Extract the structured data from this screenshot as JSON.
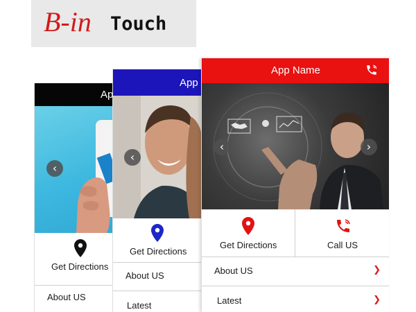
{
  "logo": {
    "b_in": "B-in",
    "touch": "Touch"
  },
  "phones": {
    "back": {
      "header_title": "Ap",
      "tiles": {
        "directions_label": "Get Directions"
      },
      "menu": [
        {
          "label": "About US"
        }
      ]
    },
    "middle": {
      "header_title": "App",
      "tiles": {
        "directions_label": "Get Directions"
      },
      "menu": [
        {
          "label": "About US"
        },
        {
          "label": "Latest"
        }
      ]
    },
    "front": {
      "header_title": "App Name",
      "tiles": {
        "directions_label": "Get Directions",
        "call_label": "Call US"
      },
      "menu": [
        {
          "label": "About US"
        },
        {
          "label": "Latest"
        }
      ]
    }
  },
  "icons": {
    "phone_icon": "phone-icon",
    "pin_icon": "map-pin-icon",
    "prev": "chevron-left-icon",
    "next": "chevron-right-icon"
  },
  "colors": {
    "brand_red": "#ea1111",
    "blue_header": "#1c15b9",
    "black_header": "#060606",
    "pin_black": "#111111",
    "pin_blue": "#1c28c8",
    "pin_red": "#e21212"
  }
}
